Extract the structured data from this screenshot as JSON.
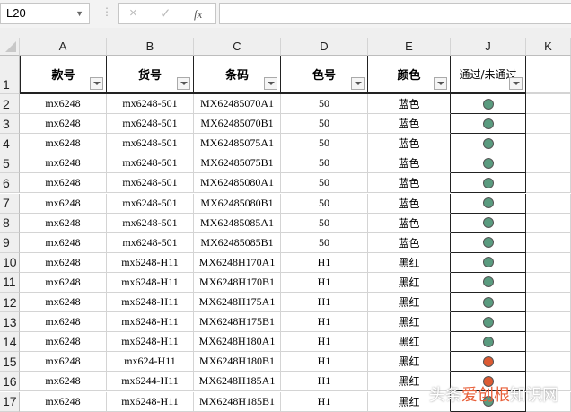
{
  "formula_bar": {
    "name_box": "L20",
    "cancel_icon": "×",
    "enter_icon": "✓",
    "fx_label": "fx",
    "formula": ""
  },
  "columns": [
    "A",
    "B",
    "C",
    "D",
    "E",
    "J",
    "K"
  ],
  "header_row": {
    "row_number": "1",
    "cells": [
      "款号",
      "货号",
      "条码",
      "色号",
      "颜色",
      "通过/未通过"
    ]
  },
  "status_colors": {
    "pass": "#5a9b7f",
    "fail": "#dc5a32"
  },
  "rows": [
    {
      "n": "2",
      "cells": [
        "mx6248",
        "mx6248-501",
        "MX62485070A1",
        "50",
        "蓝色"
      ],
      "status": "pass"
    },
    {
      "n": "3",
      "cells": [
        "mx6248",
        "mx6248-501",
        "MX62485070B1",
        "50",
        "蓝色"
      ],
      "status": "pass"
    },
    {
      "n": "4",
      "cells": [
        "mx6248",
        "mx6248-501",
        "MX62485075A1",
        "50",
        "蓝色"
      ],
      "status": "pass"
    },
    {
      "n": "5",
      "cells": [
        "mx6248",
        "mx6248-501",
        "MX62485075B1",
        "50",
        "蓝色"
      ],
      "status": "pass"
    },
    {
      "n": "6",
      "cells": [
        "mx6248",
        "mx6248-501",
        "MX62485080A1",
        "50",
        "蓝色"
      ],
      "status": "pass"
    },
    {
      "n": "7",
      "cells": [
        "mx6248",
        "mx6248-501",
        "MX62485080B1",
        "50",
        "蓝色"
      ],
      "status": "pass"
    },
    {
      "n": "8",
      "cells": [
        "mx6248",
        "mx6248-501",
        "MX62485085A1",
        "50",
        "蓝色"
      ],
      "status": "pass"
    },
    {
      "n": "9",
      "cells": [
        "mx6248",
        "mx6248-501",
        "MX62485085B1",
        "50",
        "蓝色"
      ],
      "status": "pass"
    },
    {
      "n": "10",
      "cells": [
        "mx6248",
        "mx6248-H11",
        "MX6248H170A1",
        "H1",
        "黑红"
      ],
      "status": "pass"
    },
    {
      "n": "11",
      "cells": [
        "mx6248",
        "mx6248-H11",
        "MX6248H170B1",
        "H1",
        "黑红"
      ],
      "status": "pass"
    },
    {
      "n": "12",
      "cells": [
        "mx6248",
        "mx6248-H11",
        "MX6248H175A1",
        "H1",
        "黑红"
      ],
      "status": "pass"
    },
    {
      "n": "13",
      "cells": [
        "mx6248",
        "mx6248-H11",
        "MX6248H175B1",
        "H1",
        "黑红"
      ],
      "status": "pass"
    },
    {
      "n": "14",
      "cells": [
        "mx6248",
        "mx6248-H11",
        "MX6248H180A1",
        "H1",
        "黑红"
      ],
      "status": "pass"
    },
    {
      "n": "15",
      "cells": [
        "mx6248",
        "mx624-H11",
        "MX6248H180B1",
        "H1",
        "黑红"
      ],
      "status": "fail"
    },
    {
      "n": "16",
      "cells": [
        "mx6248",
        "mx6244-H11",
        "MX6248H185A1",
        "H1",
        "黑红"
      ],
      "status": "fail"
    },
    {
      "n": "17",
      "cells": [
        "mx6248",
        "mx6248-H11",
        "MX6248H185B1",
        "H1",
        "黑红"
      ],
      "status": "pass"
    }
  ],
  "watermark": {
    "prefix": "头条",
    "brand": "爱创根",
    "suffix": "知识网"
  }
}
